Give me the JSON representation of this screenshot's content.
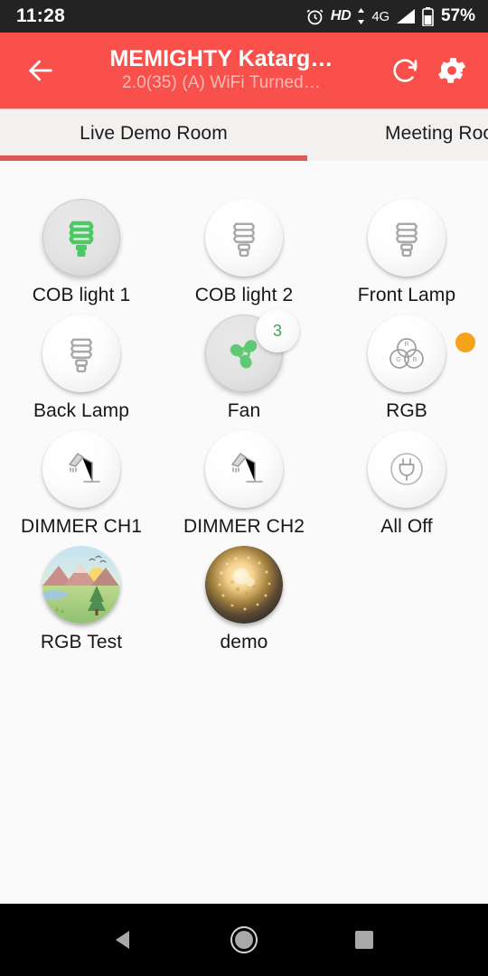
{
  "statusbar": {
    "time": "11:28",
    "alarm_icon": "alarm-clock-icon",
    "hd_label": "HD",
    "network_label": "4G",
    "signal_icon": "signal-bars-icon",
    "battery_icon": "battery-icon",
    "battery_level": "57%"
  },
  "appbar": {
    "back_icon": "arrow-left-icon",
    "title": "MEMIGHTY Katarg…",
    "subtitle": "2.0(35) (A) WiFi Turned…",
    "refresh_icon": "refresh-icon",
    "settings_icon": "gear-icon",
    "accent_color": "#F9504C"
  },
  "tabs": {
    "active_index": 0,
    "items": [
      {
        "label": "Live Demo Room"
      },
      {
        "label": "Meeting Roo"
      }
    ],
    "indicator_color": "#DB5A5A"
  },
  "content": {
    "status_dot": {
      "name": "connection-status-dot",
      "color": "#F5A31B"
    },
    "devices": [
      {
        "label": "COB light 1",
        "icon": "cfl-bulb-icon",
        "state": "on",
        "badge": null
      },
      {
        "label": "COB light 2",
        "icon": "cfl-bulb-icon",
        "state": "off",
        "badge": null
      },
      {
        "label": "Front Lamp",
        "icon": "cfl-bulb-icon",
        "state": "off",
        "badge": null
      },
      {
        "label": "Back Lamp",
        "icon": "cfl-bulb-icon",
        "state": "off",
        "badge": null
      },
      {
        "label": "Fan",
        "icon": "fan-icon",
        "state": "on",
        "badge": "3"
      },
      {
        "label": "RGB",
        "icon": "rgb-venn-icon",
        "state": "off",
        "badge": null
      },
      {
        "label": "DIMMER CH1",
        "icon": "desk-lamp-icon",
        "state": "off",
        "badge": null
      },
      {
        "label": "DIMMER CH2",
        "icon": "desk-lamp-icon",
        "state": "off",
        "badge": null
      },
      {
        "label": "All Off",
        "icon": "power-plug-icon",
        "state": "off",
        "badge": null
      },
      {
        "label": "RGB Test",
        "icon": "landscape-photo-icon",
        "state": "photo-landscape",
        "badge": null
      },
      {
        "label": "demo",
        "icon": "glowing-sphere-photo-icon",
        "state": "photo-sphere",
        "badge": null
      }
    ],
    "on_color": "#4CC964"
  },
  "navbar": {
    "back_icon": "nav-back-triangle-icon",
    "home_icon": "nav-home-circle-icon",
    "recents_icon": "nav-recents-square-icon"
  }
}
